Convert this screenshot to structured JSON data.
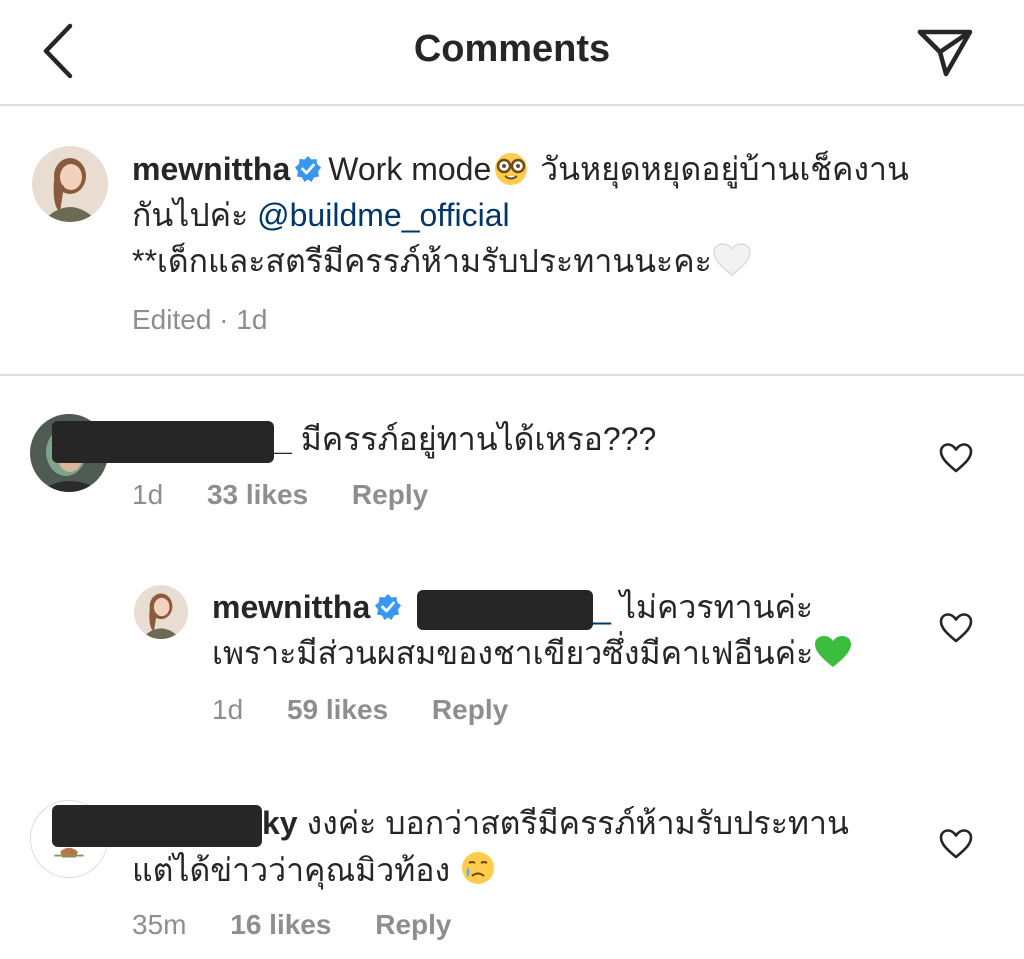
{
  "header": {
    "title": "Comments"
  },
  "caption": {
    "username": "mewnittha",
    "line1": "Work mode",
    "line1_rest": " วันหยุดหยุดอยู่บ้านเช็คงาน",
    "line2_prefix": "กันไปค่ะ ",
    "mention": "@buildme_official",
    "line3": "**เด็กและสตรีมีครรภ์ห้ามรับประทานนะคะ",
    "meta": "Edited · 1d"
  },
  "comments": [
    {
      "username_suffix": "_",
      "text": " มีครรภ์อยู่ทานได้เหรอ???",
      "time": "1d",
      "likes": "33 likes",
      "reply": "Reply"
    },
    {
      "username": "mewnittha",
      "mention_suffix": "_",
      "text_line1": " ไม่ควรทานค่ะ",
      "text_line2": "เพราะมีส่วนผสมของชาเขียวซึ่งมีคาเฟอีนค่ะ",
      "time": "1d",
      "likes": "59 likes",
      "reply": "Reply"
    },
    {
      "username_suffix": "ky",
      "text_line1": " งงค่ะ บอกว่าสตรีมีครรภ์ห้ามรับประทาน",
      "text_line2": "แต่ได้ข่าวว่าคุณมิวท้อง ",
      "time": "35m",
      "likes": "16 likes",
      "reply": "Reply"
    }
  ],
  "colors": {
    "verified": "#3897f0",
    "mention": "#00376b",
    "meta": "#8e8e8e",
    "divider": "#dbdbdb"
  }
}
